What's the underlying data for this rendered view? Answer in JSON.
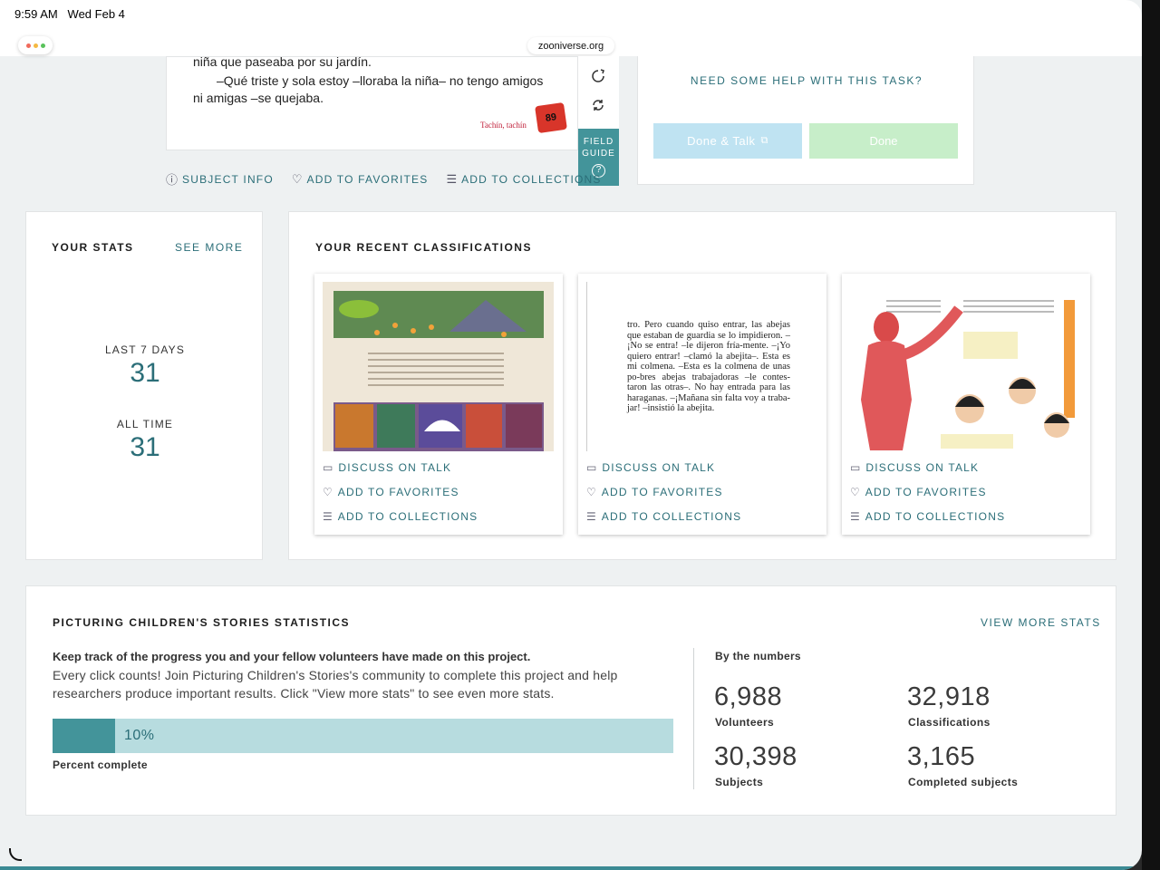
{
  "status_bar": {
    "time": "9:59 AM",
    "date": "Wed Feb 4",
    "url": "zooniverse.org"
  },
  "subject": {
    "story_lines": [
      "niña que paseaba por su jardín.",
      "–Qué triste y sola estoy –lloraba la niña– no tengo amigos",
      "ni amigas –se quejaba."
    ],
    "caption": "Tachín, tachín",
    "page_number": "89"
  },
  "field_guide": {
    "label_1": "FIELD",
    "label_2": "GUIDE",
    "help": "?"
  },
  "subject_actions": {
    "info": "SUBJECT INFO",
    "favorites": "ADD TO FAVORITES",
    "collections": "ADD TO COLLECTIONS"
  },
  "task": {
    "help_link": "NEED SOME HELP WITH THIS TASK?",
    "done_talk": "Done & Talk",
    "done": "Done"
  },
  "your_stats": {
    "title": "YOUR STATS",
    "see_more": "SEE MORE",
    "last7_label": "LAST 7 DAYS",
    "last7_value": "31",
    "all_time_label": "ALL TIME",
    "all_time_value": "31"
  },
  "recent": {
    "title": "YOUR RECENT CLASSIFICATIONS",
    "actions": {
      "talk": "DISCUSS ON TALK",
      "favorites": "ADD TO FAVORITES",
      "collections": "ADD TO COLLECTIONS"
    },
    "thumb2_text": "tro. Pero cuando quiso entrar, las abejas que estaban de guardia se lo impidieron. –¡No se entra! –le dijeron fría-mente. –¡Yo quiero entrar! –clamó la abejita–. Esta es mi colmena. –Esta es la colmena de unas po-bres abejas trabajadoras –le contes-taron las otras–. No hay entrada para las haraganas. –¡Mañana sin falta voy a traba-jar! –insistió la abejita."
  },
  "project_stats": {
    "title": "PICTURING CHILDREN'S STORIES STATISTICS",
    "view_more": "VIEW MORE STATS",
    "lead": "Keep track of the progress you and your fellow volunteers have made on this project.",
    "description": "Every click counts! Join Picturing Children's Stories's community to complete this project and help researchers produce important results. Click \"View more stats\" to see even more stats.",
    "progress_percent": 10,
    "progress_label": "10%",
    "progress_caption": "Percent complete",
    "by_numbers": "By the numbers",
    "volunteers_value": "6,988",
    "volunteers_label": "Volunteers",
    "classifications_value": "32,918",
    "classifications_label": "Classifications",
    "subjects_value": "30,398",
    "subjects_label": "Subjects",
    "completed_value": "3,165",
    "completed_label": "Completed subjects"
  },
  "colors": {
    "teal": "#43949a",
    "link": "#2b6e78",
    "light_teal": "#b7dcdf"
  }
}
